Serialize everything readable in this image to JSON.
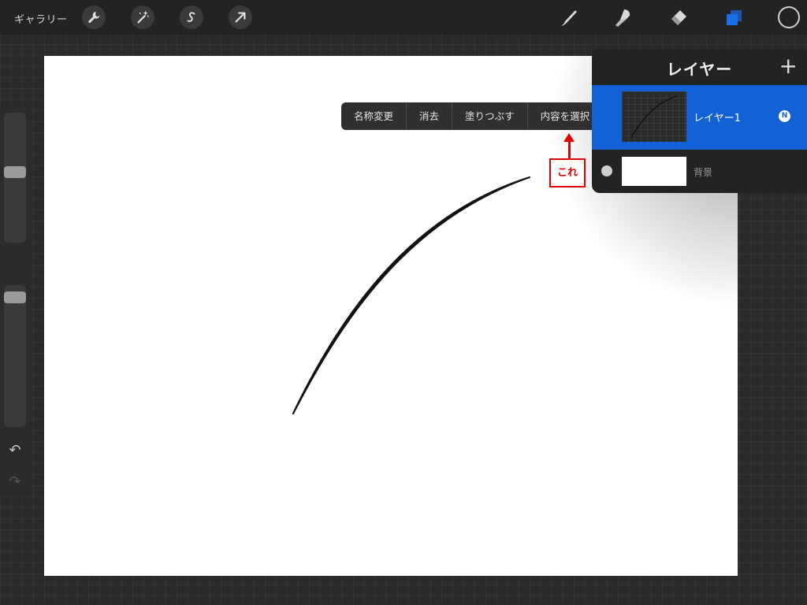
{
  "toolbar": {
    "gallery_label": "ギャラリー",
    "left_tools": [
      {
        "icon": "wrench-icon",
        "name": "actions"
      },
      {
        "icon": "magic-wand-icon",
        "name": "adjustments"
      },
      {
        "icon": "selection-s-icon",
        "name": "selection"
      },
      {
        "icon": "arrow-cursor-icon",
        "name": "transform"
      }
    ],
    "right_tools": [
      {
        "icon": "brush-icon",
        "name": "paint"
      },
      {
        "icon": "smudge-icon",
        "name": "smudge"
      },
      {
        "icon": "eraser-icon",
        "name": "erase"
      },
      {
        "icon": "layers-icon",
        "name": "layers",
        "active": true,
        "color": "#1a6ee8"
      }
    ],
    "color_swatch": "#222222"
  },
  "sidebar": {
    "brush_size_level": 0.55,
    "opacity_level": 0.95,
    "undo_icon": "undo-icon",
    "redo_icon": "redo-icon"
  },
  "context_menu": {
    "items": [
      "名称変更",
      "消去",
      "塗りつぶす",
      "内容を選択"
    ]
  },
  "annotation": {
    "label": "これ",
    "color": "#e00000"
  },
  "layers_panel": {
    "title": "レイヤー",
    "add_label": "+",
    "layers": [
      {
        "name": "レイヤー1",
        "blend": "N",
        "active": true,
        "color": "#1262d6"
      },
      {
        "name": "背景",
        "active": false
      }
    ]
  }
}
